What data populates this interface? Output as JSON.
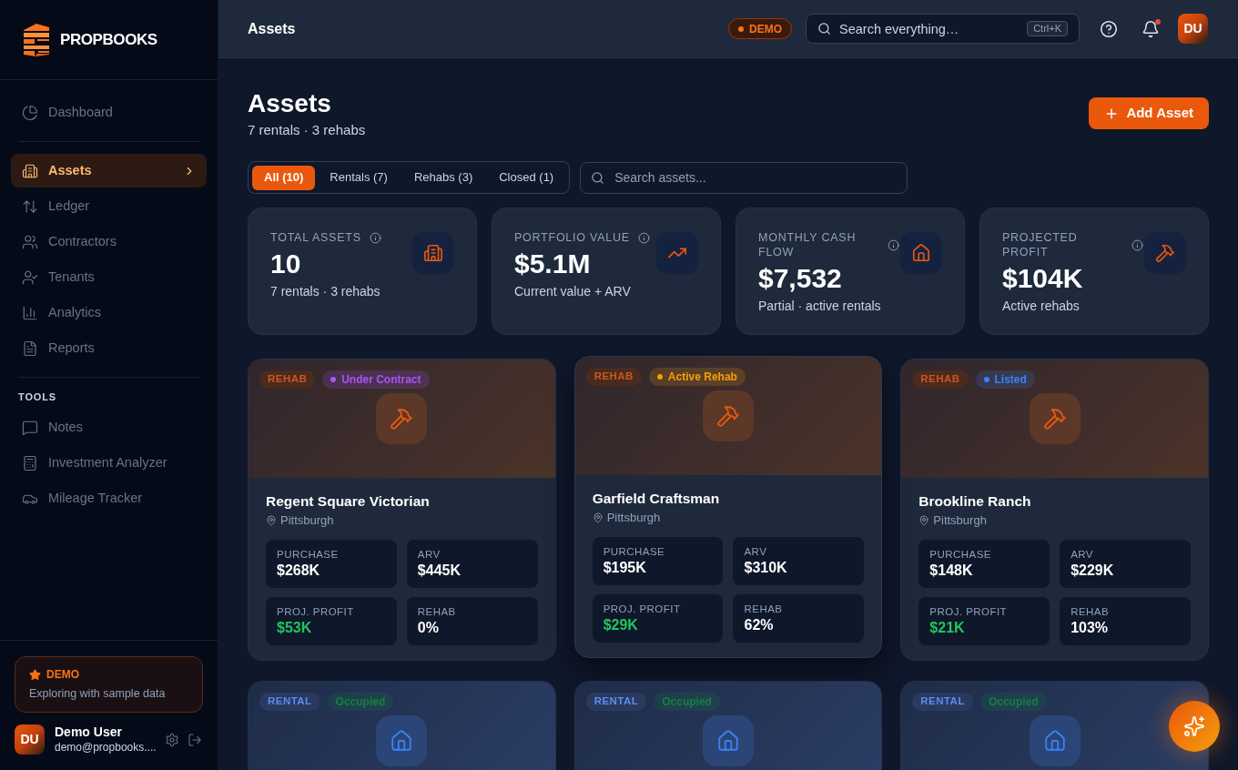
{
  "sidebar": {
    "brand": "PROPBOOKS",
    "nav_groups": [
      {
        "items": [
          {
            "label": "Dashboard",
            "selected": false
          }
        ]
      },
      {
        "items": [
          {
            "label": "Assets",
            "selected": true
          },
          {
            "label": "Ledger",
            "selected": false
          },
          {
            "label": "Contractors",
            "selected": false
          },
          {
            "label": "Tenants",
            "selected": false
          },
          {
            "label": "Analytics",
            "selected": false
          },
          {
            "label": "Reports",
            "selected": false
          }
        ]
      },
      {
        "heading": "TOOLS",
        "items": [
          {
            "label": "Notes",
            "selected": false
          },
          {
            "label": "Investment Analyzer",
            "selected": false
          },
          {
            "label": "Mileage Tracker",
            "selected": false
          }
        ]
      }
    ],
    "demo_card": {
      "badge": "DEMO",
      "text": "Exploring with sample data"
    },
    "user": {
      "initials": "DU",
      "name": "Demo User",
      "email": "demo@propbooks...."
    }
  },
  "header": {
    "title": "Assets",
    "demo_badge": "DEMO",
    "search": {
      "placeholder": "Search everything…",
      "shortcut": "Ctrl+K"
    },
    "notifications": {
      "unread": true
    },
    "avatar": "DU"
  },
  "page": {
    "title": "Assets",
    "subtitle": "7 rentals · 3 rehabs",
    "add_button": "Add Asset",
    "filter_tabs": [
      {
        "label": "All (10)",
        "selected": true
      },
      {
        "label": "Rentals (7)",
        "selected": false
      },
      {
        "label": "Rehabs (3)",
        "selected": false
      },
      {
        "label": "Closed (1)",
        "selected": false
      }
    ],
    "search": {
      "placeholder": "Search assets..."
    }
  },
  "stat_cards": [
    {
      "label": "TOTAL ASSETS",
      "value": "10",
      "caption": "7 rentals · 3 rehabs"
    },
    {
      "label": "PORTFOLIO VALUE",
      "value": "$5.1M",
      "caption": "Current value + ARV"
    },
    {
      "label": "MONTHLY CASH FLOW",
      "value": "$7,532",
      "caption": "Partial · active rentals"
    },
    {
      "label": "PROJECTED PROFIT",
      "value": "$104K",
      "caption": "Active rehabs"
    }
  ],
  "asset_cards": [
    {
      "kind": "flip",
      "tag": "REHAB",
      "status": {
        "label": "Under Contract",
        "color": "#a855f7",
        "dot": true
      },
      "hovered": false,
      "title": "Regent Square Victorian",
      "location": "Pittsburgh",
      "metrics": [
        {
          "label": "PURCHASE",
          "value": "$268K",
          "positive": false
        },
        {
          "label": "ARV",
          "value": "$445K",
          "positive": false
        },
        {
          "label": "PROJ. PROFIT",
          "value": "$53K",
          "positive": true
        },
        {
          "label": "REHAB",
          "value": "0%",
          "positive": false
        }
      ]
    },
    {
      "kind": "flip",
      "tag": "REHAB",
      "status": {
        "label": "Active Rehab",
        "color": "#f59e0b",
        "dot": true
      },
      "hovered": true,
      "title": "Garfield Craftsman",
      "location": "Pittsburgh",
      "metrics": [
        {
          "label": "PURCHASE",
          "value": "$195K",
          "positive": false
        },
        {
          "label": "ARV",
          "value": "$310K",
          "positive": false
        },
        {
          "label": "PROJ. PROFIT",
          "value": "$29K",
          "positive": true
        },
        {
          "label": "REHAB",
          "value": "62%",
          "positive": false
        }
      ]
    },
    {
      "kind": "flip",
      "tag": "REHAB",
      "status": {
        "label": "Listed",
        "color": "#3b82f6",
        "dot": true
      },
      "hovered": false,
      "title": "Brookline Ranch",
      "location": "Pittsburgh",
      "metrics": [
        {
          "label": "PURCHASE",
          "value": "$148K",
          "positive": false
        },
        {
          "label": "ARV",
          "value": "$229K",
          "positive": false
        },
        {
          "label": "PROJ. PROFIT",
          "value": "$21K",
          "positive": true
        },
        {
          "label": "REHAB",
          "value": "103%",
          "positive": false
        }
      ]
    },
    {
      "kind": "hold",
      "tag": "RENTAL",
      "status": {
        "label": "Occupied",
        "color": "#15803d",
        "dot": false
      },
      "hovered": false
    },
    {
      "kind": "hold",
      "tag": "RENTAL",
      "status": {
        "label": "Occupied",
        "color": "#15803d",
        "dot": false
      },
      "hovered": false
    },
    {
      "kind": "hold",
      "tag": "RENTAL",
      "status": {
        "label": "Occupied",
        "color": "#15803d",
        "dot": false
      },
      "hovered": false
    }
  ]
}
